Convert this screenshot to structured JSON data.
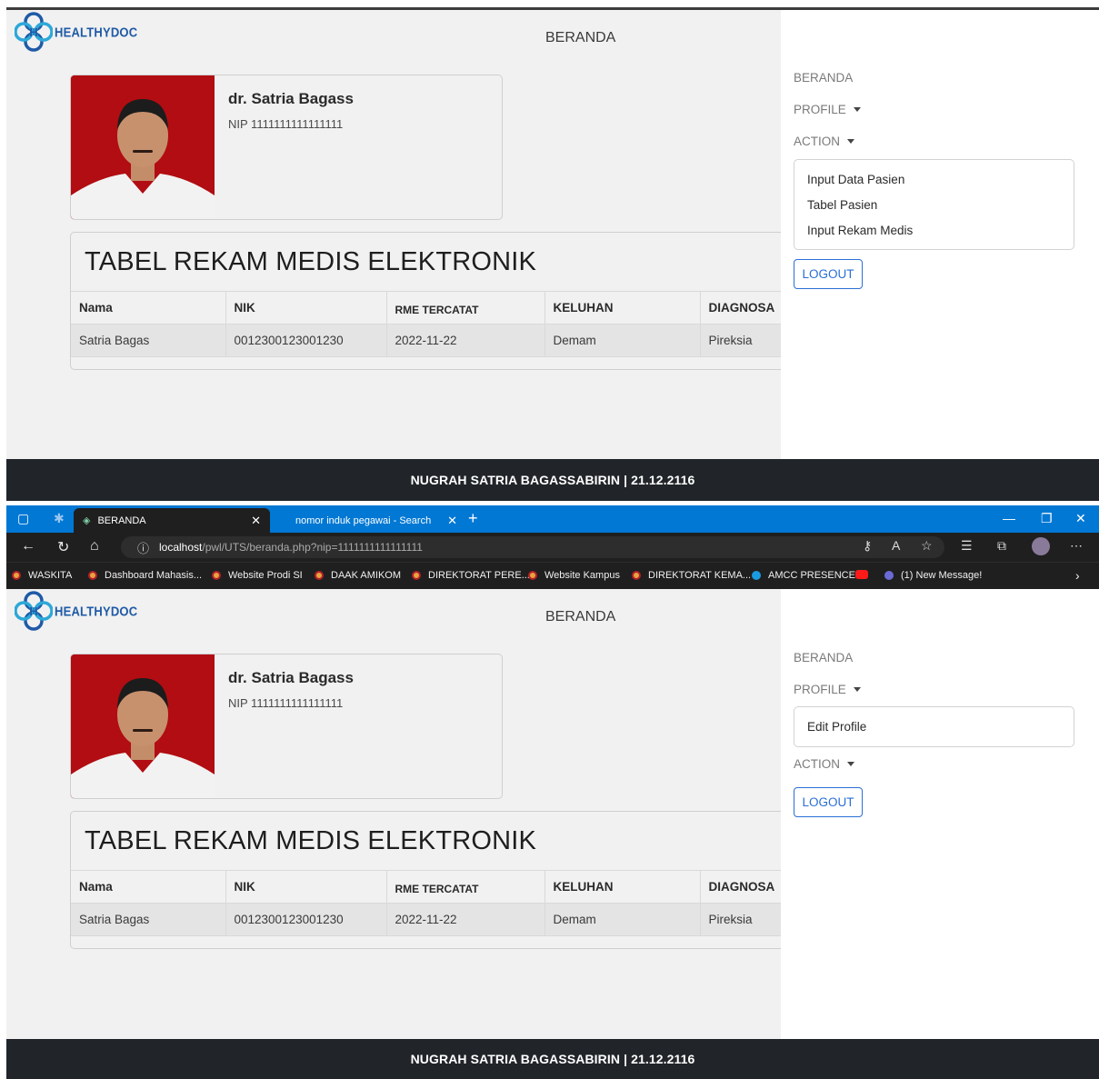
{
  "brand": {
    "logo_text": "HEALTHYDOC"
  },
  "navbar": {
    "title": "BERANDA"
  },
  "doctor": {
    "name": "dr. Satria Bagass",
    "nip": "NIP 1111111111111111"
  },
  "table": {
    "title": "TABEL REKAM MEDIS ELEKTRONIK",
    "headers": [
      "Nama",
      "NIK",
      "RME TERCATAT",
      "KELUHAN",
      "DIAGNOSA"
    ],
    "rows": [
      [
        "Satria Bagas",
        "0012300123001230",
        "2022-11-22",
        "Demam",
        "Pireksia"
      ]
    ]
  },
  "sidebar": {
    "beranda": "BERANDA",
    "profile": "PROFILE",
    "action": "ACTION",
    "action_items": [
      "Input Data Pasien",
      "Tabel Pasien",
      "Input Rekam Medis"
    ],
    "profile_items": [
      "Edit Profile"
    ],
    "logout": "LOGOUT"
  },
  "footer": {
    "text": "NUGRAH SATRIA BAGASSABIRIN | 21.12.2116"
  },
  "browser": {
    "active_tab": "BERANDA",
    "inactive_tab": "nomor induk pegawai - Search",
    "url_host": "localhost",
    "url_path": "/pwl/UTS/beranda.php?nip=1111111111111111",
    "bookmarks": [
      "WASKITA",
      "Dashboard Mahasis...",
      "Website Prodi SI",
      "DAAK AMIKOM",
      "DIREKTORAT PERE...",
      "Website Kampus",
      "DIREKTORAT KEMA...",
      "AMCC PRESENCE",
      "",
      "(1) New Message!"
    ]
  },
  "colors": {
    "accent": "#2a6fd6",
    "footer_bg": "#212529",
    "photo_bg": "#b10d12",
    "edge_tab": "#0078d4"
  }
}
